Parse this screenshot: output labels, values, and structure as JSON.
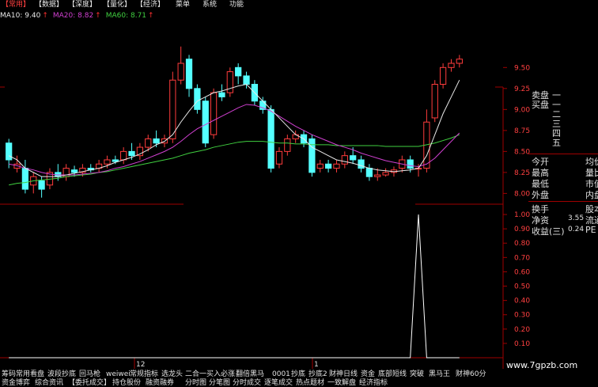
{
  "menubar": {
    "items": [
      {
        "label": "【常用】",
        "active": true
      },
      {
        "label": "【数据】",
        "active": false
      },
      {
        "label": "【深度】",
        "active": false
      },
      {
        "label": "【量化】",
        "active": false
      },
      {
        "label": "【经济】",
        "active": false
      },
      {
        "label": "菜单",
        "active": false
      },
      {
        "label": "系统",
        "active": false
      },
      {
        "label": "功能",
        "active": false
      }
    ]
  },
  "ma_legend": [
    {
      "label": "MA10: 9.40",
      "color": "#e8e8e8"
    },
    {
      "label": "MA20: 8.82",
      "color": "#d040d0"
    },
    {
      "label": "MA60: 8.71",
      "color": "#40d040"
    }
  ],
  "ma_arrow": "↑",
  "price_axis": {
    "labels": [
      "9.50",
      "9.25",
      "9.00",
      "8.75",
      "8.50",
      "8.25",
      "8.00"
    ]
  },
  "indicator_axis": {
    "labels": [
      "1.00",
      "0.90",
      "0.80",
      "0.70",
      "0.60",
      "0.50",
      "0.40",
      "0.30",
      "0.20",
      "0.10"
    ]
  },
  "x_markers": [
    "12",
    "1"
  ],
  "quote_panel": {
    "orderbook": [
      {
        "label": "卖盘",
        "value": "一"
      },
      {
        "label": "买盘",
        "value": "一"
      },
      {
        "label": "",
        "value": "二"
      },
      {
        "label": "",
        "value": "三"
      },
      {
        "label": "",
        "value": "四"
      },
      {
        "label": "",
        "value": "五"
      }
    ],
    "left_fields": [
      "今开",
      "最高",
      "最低",
      "外盘",
      "换手",
      "净资",
      "收益(三)"
    ],
    "right_fields": [
      "均价",
      "量比",
      "市值",
      "内盘",
      "股本",
      "流通",
      "PE"
    ],
    "values": {
      "net_assets": "3.55",
      "earnings": "0.24"
    }
  },
  "tabs_row1": [
    "筹码",
    "常用看盘",
    "波段抄底",
    "回马枪",
    "weiwei",
    "常规指标",
    "选龙头",
    "二合一买入必涨",
    "翻倍黑马",
    "0001",
    "抄底",
    "抄底2",
    "财神日线",
    "资金",
    "底部短线",
    "突破",
    "黑马王",
    "财神60分"
  ],
  "tabs_row2": [
    "资金博弈",
    "综合资讯",
    "【委托成交】",
    "持仓股份",
    "融资融券",
    "分时图",
    "分笔图",
    "分时成交",
    "逐笔成交",
    "热点题材",
    "一致解盘",
    "经济指标"
  ],
  "watermark": "www.7gpzb.com",
  "chart_data": {
    "type": "candlestick",
    "y_range": [
      7.9,
      9.55
    ],
    "candles": [
      {
        "o": 8.6,
        "c": 8.4,
        "h": 8.65,
        "l": 8.3
      },
      {
        "o": 8.3,
        "c": 8.35,
        "h": 8.45,
        "l": 8.25
      },
      {
        "o": 8.3,
        "c": 8.05,
        "h": 8.4,
        "l": 8.0
      },
      {
        "o": 8.1,
        "c": 8.2,
        "h": 8.25,
        "l": 8.0
      },
      {
        "o": 8.15,
        "c": 8.05,
        "h": 8.2,
        "l": 7.95
      },
      {
        "o": 8.1,
        "c": 8.25,
        "h": 8.3,
        "l": 8.05
      },
      {
        "o": 8.25,
        "c": 8.2,
        "h": 8.35,
        "l": 8.15
      },
      {
        "o": 8.2,
        "c": 8.3,
        "h": 8.35,
        "l": 8.15
      },
      {
        "o": 8.28,
        "c": 8.25,
        "h": 8.33,
        "l": 8.2
      },
      {
        "o": 8.25,
        "c": 8.3,
        "h": 8.35,
        "l": 8.2
      },
      {
        "o": 8.3,
        "c": 8.28,
        "h": 8.35,
        "l": 8.25
      },
      {
        "o": 8.3,
        "c": 8.35,
        "h": 8.4,
        "l": 8.25
      },
      {
        "o": 8.35,
        "c": 8.4,
        "h": 8.45,
        "l": 8.3
      },
      {
        "o": 8.4,
        "c": 8.38,
        "h": 8.45,
        "l": 8.35
      },
      {
        "o": 8.4,
        "c": 8.5,
        "h": 8.55,
        "l": 8.35
      },
      {
        "o": 8.5,
        "c": 8.45,
        "h": 8.6,
        "l": 8.4
      },
      {
        "o": 8.45,
        "c": 8.55,
        "h": 8.6,
        "l": 8.4
      },
      {
        "o": 8.55,
        "c": 8.65,
        "h": 8.7,
        "l": 8.5
      },
      {
        "o": 8.65,
        "c": 8.6,
        "h": 8.75,
        "l": 8.55
      },
      {
        "o": 8.6,
        "c": 8.65,
        "h": 8.7,
        "l": 8.55
      },
      {
        "o": 8.65,
        "c": 9.35,
        "h": 9.45,
        "l": 8.6
      },
      {
        "o": 9.35,
        "c": 9.55,
        "h": 9.75,
        "l": 9.3
      },
      {
        "o": 9.6,
        "c": 9.25,
        "h": 9.65,
        "l": 9.15
      },
      {
        "o": 9.25,
        "c": 9.0,
        "h": 9.3,
        "l": 8.95
      },
      {
        "o": 9.1,
        "c": 8.6,
        "h": 9.15,
        "l": 8.55
      },
      {
        "o": 8.7,
        "c": 9.2,
        "h": 9.25,
        "l": 8.65
      },
      {
        "o": 9.2,
        "c": 9.15,
        "h": 9.3,
        "l": 9.1
      },
      {
        "o": 9.2,
        "c": 9.45,
        "h": 9.5,
        "l": 9.15
      },
      {
        "o": 9.5,
        "c": 9.4,
        "h": 9.55,
        "l": 9.3
      },
      {
        "o": 9.4,
        "c": 9.3,
        "h": 9.45,
        "l": 9.25
      },
      {
        "o": 9.3,
        "c": 9.1,
        "h": 9.35,
        "l": 9.05
      },
      {
        "o": 9.1,
        "c": 9.0,
        "h": 9.15,
        "l": 8.95
      },
      {
        "o": 9.0,
        "c": 8.3,
        "h": 9.05,
        "l": 8.25
      },
      {
        "o": 8.35,
        "c": 8.5,
        "h": 8.55,
        "l": 8.3
      },
      {
        "o": 8.5,
        "c": 8.65,
        "h": 8.7,
        "l": 8.45
      },
      {
        "o": 8.65,
        "c": 8.7,
        "h": 8.75,
        "l": 8.6
      },
      {
        "o": 8.7,
        "c": 8.6,
        "h": 8.75,
        "l": 8.55
      },
      {
        "o": 8.65,
        "c": 8.25,
        "h": 8.7,
        "l": 8.2
      },
      {
        "o": 8.3,
        "c": 8.35,
        "h": 8.4,
        "l": 8.25
      },
      {
        "o": 8.35,
        "c": 8.3,
        "h": 8.4,
        "l": 8.25
      },
      {
        "o": 8.3,
        "c": 8.35,
        "h": 8.4,
        "l": 8.25
      },
      {
        "o": 8.35,
        "c": 8.45,
        "h": 8.5,
        "l": 8.3
      },
      {
        "o": 8.45,
        "c": 8.4,
        "h": 8.55,
        "l": 8.35
      },
      {
        "o": 8.4,
        "c": 8.3,
        "h": 8.45,
        "l": 8.25
      },
      {
        "o": 8.3,
        "c": 8.2,
        "h": 8.35,
        "l": 8.15
      },
      {
        "o": 8.2,
        "c": 8.22,
        "h": 8.3,
        "l": 8.15
      },
      {
        "o": 8.22,
        "c": 8.25,
        "h": 8.3,
        "l": 8.2
      },
      {
        "o": 8.25,
        "c": 8.28,
        "h": 8.32,
        "l": 8.2
      },
      {
        "o": 8.3,
        "c": 8.4,
        "h": 8.45,
        "l": 8.25
      },
      {
        "o": 8.4,
        "c": 8.3,
        "h": 8.45,
        "l": 8.25
      },
      {
        "o": 8.3,
        "c": 8.3,
        "h": 8.35,
        "l": 8.2
      },
      {
        "o": 8.3,
        "c": 8.85,
        "h": 9.0,
        "l": 8.25
      },
      {
        "o": 8.9,
        "c": 9.3,
        "h": 9.35,
        "l": 8.85
      },
      {
        "o": 9.3,
        "c": 9.5,
        "h": 9.55,
        "l": 9.25
      },
      {
        "o": 9.5,
        "c": 9.55,
        "h": 9.6,
        "l": 9.45
      },
      {
        "o": 9.55,
        "c": 9.6,
        "h": 9.65,
        "l": 9.5
      }
    ],
    "ma_white": [
      8.45,
      8.4,
      8.3,
      8.25,
      8.2,
      8.2,
      8.2,
      8.22,
      8.24,
      8.26,
      8.28,
      8.3,
      8.33,
      8.37,
      8.4,
      8.43,
      8.47,
      8.52,
      8.58,
      8.62,
      8.7,
      8.85,
      8.98,
      9.1,
      9.15,
      9.2,
      9.22,
      9.25,
      9.28,
      9.3,
      9.2,
      9.1,
      9.0,
      8.9,
      8.8,
      8.7,
      8.65,
      8.55,
      8.5,
      8.45,
      8.4,
      8.38,
      8.36,
      8.33,
      8.3,
      8.28,
      8.27,
      8.26,
      8.27,
      8.28,
      8.3,
      8.45,
      8.7,
      8.95,
      9.15,
      9.35
    ],
    "ma_purple": [
      8.35,
      8.33,
      8.3,
      8.28,
      8.25,
      8.23,
      8.22,
      8.22,
      8.22,
      8.23,
      8.24,
      8.25,
      8.27,
      8.3,
      8.32,
      8.35,
      8.38,
      8.42,
      8.46,
      8.5,
      8.55,
      8.62,
      8.7,
      8.77,
      8.82,
      8.87,
      8.92,
      8.97,
      9.02,
      9.06,
      9.05,
      9.02,
      8.98,
      8.92,
      8.86,
      8.8,
      8.75,
      8.7,
      8.66,
      8.62,
      8.58,
      8.55,
      8.52,
      8.48,
      8.45,
      8.42,
      8.39,
      8.37,
      8.35,
      8.33,
      8.32,
      8.35,
      8.42,
      8.52,
      8.62,
      8.72
    ],
    "ma_green": [
      8.1,
      8.12,
      8.13,
      8.15,
      8.16,
      8.17,
      8.18,
      8.2,
      8.21,
      8.22,
      8.23,
      8.25,
      8.26,
      8.28,
      8.3,
      8.32,
      8.34,
      8.36,
      8.38,
      8.4,
      8.42,
      8.45,
      8.48,
      8.5,
      8.52,
      8.55,
      8.57,
      8.59,
      8.61,
      8.62,
      8.62,
      8.62,
      8.61,
      8.6,
      8.6,
      8.59,
      8.59,
      8.58,
      8.58,
      8.58,
      8.57,
      8.57,
      8.57,
      8.57,
      8.57,
      8.57,
      8.56,
      8.56,
      8.56,
      8.56,
      8.56,
      8.58,
      8.6,
      8.63,
      8.66,
      8.7
    ],
    "indicator": {
      "y_range": [
        0,
        1.05
      ],
      "series": [
        0,
        0,
        0,
        0,
        0,
        0,
        0,
        0,
        0,
        0,
        0,
        0,
        0,
        0,
        0,
        0,
        0,
        0,
        0,
        0,
        0,
        0,
        0,
        0,
        0,
        0,
        0,
        0,
        0,
        0,
        0,
        0,
        0,
        0,
        0,
        0,
        0,
        0,
        0,
        0,
        0,
        0,
        0,
        0,
        0,
        0,
        0,
        0,
        0,
        0,
        1.0,
        0,
        0,
        0,
        0,
        0
      ]
    }
  }
}
